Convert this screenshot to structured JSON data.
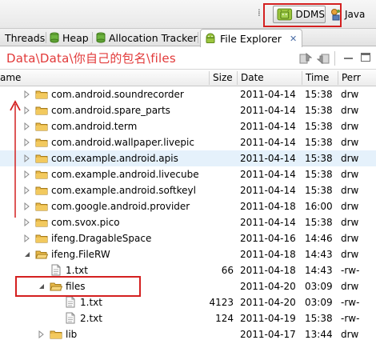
{
  "perspectives": {
    "active_label": "DDMS",
    "other_label": "Java"
  },
  "tabs": [
    {
      "label": "Threads"
    },
    {
      "label": "Heap"
    },
    {
      "label": "Allocation Tracker"
    },
    {
      "label": "File Explorer"
    }
  ],
  "annotation": "Data\\Data\\你自己的包名\\files",
  "columns": {
    "name": "ame",
    "size": "Size",
    "date": "Date",
    "time": "Time",
    "perm": "Perr"
  },
  "rows": [
    {
      "name": "com.android.soundrecorder",
      "size": "",
      "date": "2011-04-14",
      "time": "15:38",
      "perm": "drw",
      "type": "folder",
      "expanded": false
    },
    {
      "name": "com.android.spare_parts",
      "size": "",
      "date": "2011-04-14",
      "time": "15:38",
      "perm": "drw",
      "type": "folder",
      "expanded": false
    },
    {
      "name": "com.android.term",
      "size": "",
      "date": "2011-04-14",
      "time": "15:38",
      "perm": "drw",
      "type": "folder",
      "expanded": false
    },
    {
      "name": "com.android.wallpaper.livepic",
      "size": "",
      "date": "2011-04-14",
      "time": "15:38",
      "perm": "drw",
      "type": "folder",
      "expanded": false
    },
    {
      "name": "com.example.android.apis",
      "size": "",
      "date": "2011-04-14",
      "time": "15:38",
      "perm": "drw",
      "type": "folder",
      "expanded": false,
      "selected": true
    },
    {
      "name": "com.example.android.livecube",
      "size": "",
      "date": "2011-04-14",
      "time": "15:38",
      "perm": "drw",
      "type": "folder",
      "expanded": false
    },
    {
      "name": "com.example.android.softkeyl",
      "size": "",
      "date": "2011-04-14",
      "time": "15:38",
      "perm": "drw",
      "type": "folder",
      "expanded": false
    },
    {
      "name": "com.google.android.provider",
      "size": "",
      "date": "2011-04-18",
      "time": "16:00",
      "perm": "drw",
      "type": "folder",
      "expanded": false
    },
    {
      "name": "com.svox.pico",
      "size": "",
      "date": "2011-04-14",
      "time": "15:38",
      "perm": "drw",
      "type": "folder",
      "expanded": false
    },
    {
      "name": "ifeng.DragableSpace",
      "size": "",
      "date": "2011-04-16",
      "time": "14:46",
      "perm": "drw",
      "type": "folder",
      "expanded": false
    },
    {
      "name": "ifeng.FileRW",
      "size": "",
      "date": "2011-04-18",
      "time": "14:43",
      "perm": "drw",
      "type": "folder",
      "expanded": true
    },
    {
      "name": "1.txt",
      "size": "66",
      "date": "2011-04-18",
      "time": "14:43",
      "perm": "-rw-",
      "type": "file"
    },
    {
      "name": "files",
      "size": "",
      "date": "2011-04-20",
      "time": "03:09",
      "perm": "drw",
      "type": "folder",
      "expanded": true
    },
    {
      "name": "1.txt",
      "size": "4123",
      "date": "2011-04-20",
      "time": "03:09",
      "perm": "-rw-",
      "type": "file"
    },
    {
      "name": "2.txt",
      "size": "124",
      "date": "2011-04-19",
      "time": "15:38",
      "perm": "-rw-",
      "type": "file"
    },
    {
      "name": "lib",
      "size": "",
      "date": "2011-04-17",
      "time": "13:44",
      "perm": "drw",
      "type": "folder",
      "expanded": false
    }
  ],
  "colors": {
    "annotation": "#e23a3a",
    "highlight_box": "#d42020",
    "selected_row": "#e5f1fb",
    "folder": "#e9b949"
  }
}
